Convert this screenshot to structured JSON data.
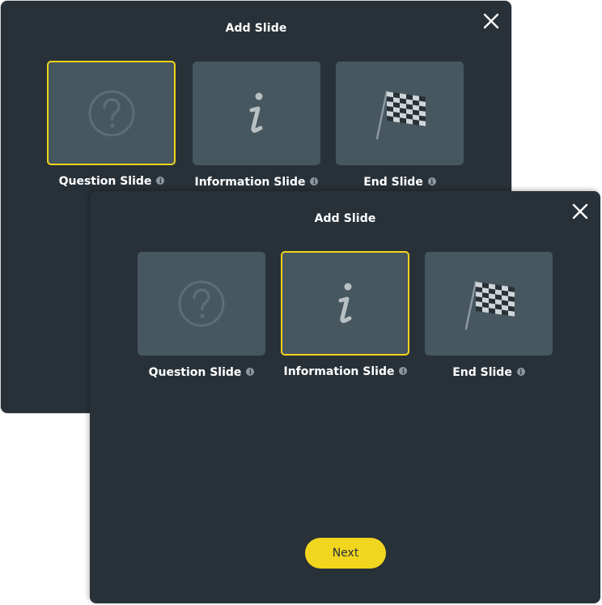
{
  "back_dialog": {
    "title": "Add Slide",
    "options": [
      {
        "label": "Question Slide",
        "icon": "question-circle-icon",
        "selected": true
      },
      {
        "label": "Information Slide",
        "icon": "information-icon",
        "selected": false
      },
      {
        "label": "End Slide",
        "icon": "checkered-flag-icon",
        "selected": false
      }
    ],
    "info_glyph": "i"
  },
  "front_dialog": {
    "title": "Add Slide",
    "options": [
      {
        "label": "Question Slide",
        "icon": "question-circle-icon",
        "selected": false
      },
      {
        "label": "Information Slide",
        "icon": "information-icon",
        "selected": true
      },
      {
        "label": "End Slide",
        "icon": "checkered-flag-icon",
        "selected": false
      }
    ],
    "info_glyph": "i",
    "next_label": "Next"
  },
  "colors": {
    "dialog_bg": "#283138",
    "tile_bg": "#465760",
    "accent": "#f2d31b",
    "icon": "#8e9aa0"
  }
}
